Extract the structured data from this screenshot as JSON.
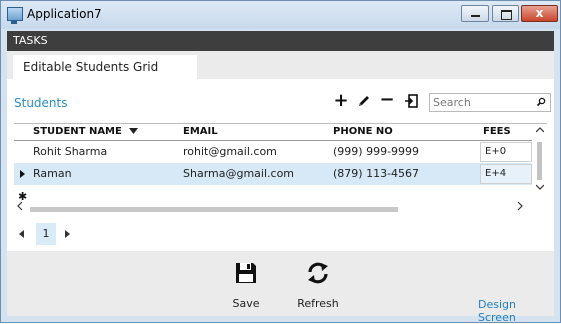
{
  "window": {
    "title": "Application7",
    "close_glyph": "x"
  },
  "tasks_label": "TASKS",
  "tab": {
    "label": "Editable Students Grid"
  },
  "screen_title": "Students",
  "toolbar": {
    "add_glyph": "+",
    "remove_glyph": "−"
  },
  "search": {
    "placeholder": "Search"
  },
  "grid": {
    "columns": [
      {
        "label": "STUDENT NAME",
        "sorted": "descending"
      },
      {
        "label": "EMAIL"
      },
      {
        "label": "PHONE NO"
      },
      {
        "label": "FEES"
      }
    ],
    "rows": [
      {
        "name": "Rohit Sharma",
        "email": "rohit@gmail.com",
        "phone": "(999) 999-9999",
        "fees": "E+0",
        "selected": false
      },
      {
        "name": "Raman",
        "email": "Sharma@gmail.com",
        "phone": "(879) 113-4567",
        "fees": "E+4",
        "selected": true
      }
    ],
    "new_row_glyph": "✱"
  },
  "pager": {
    "current_page": "1"
  },
  "commands": {
    "save": "Save",
    "refresh": "Refresh"
  },
  "design_screen": "Design Screen",
  "colors": {
    "accent": "#2a8cbf",
    "selected_row": "#d7e9f6",
    "tasks_bar": "#3e3e3e"
  },
  "icons": [
    "app-icon",
    "add-icon",
    "edit-icon",
    "remove-icon",
    "open-icon",
    "search-icon",
    "sort-desc-icon",
    "save-icon",
    "refresh-icon"
  ]
}
